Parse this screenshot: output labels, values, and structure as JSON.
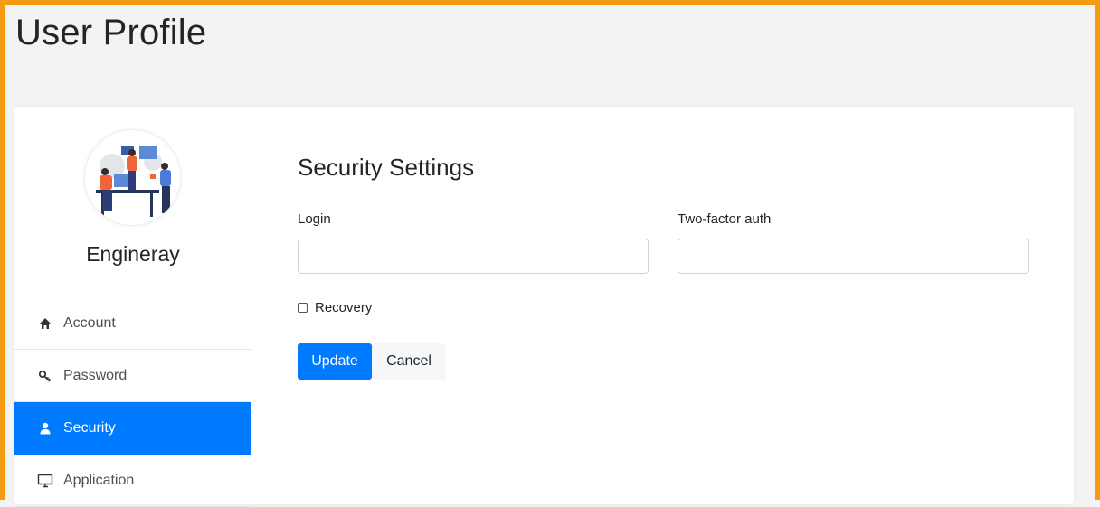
{
  "page": {
    "title": "User Profile"
  },
  "profile": {
    "name": "Engineray"
  },
  "sidebar": {
    "items": [
      {
        "label": "Account",
        "icon": "home-icon",
        "active": false
      },
      {
        "label": "Password",
        "icon": "key-icon",
        "active": false
      },
      {
        "label": "Security",
        "icon": "user-icon",
        "active": true
      },
      {
        "label": "Application",
        "icon": "monitor-icon",
        "active": false
      }
    ]
  },
  "security": {
    "title": "Security Settings",
    "login_label": "Login",
    "login_value": "",
    "twofactor_label": "Two-factor auth",
    "twofactor_value": "",
    "recovery_label": "Recovery",
    "recovery_checked": false,
    "update_label": "Update",
    "cancel_label": "Cancel"
  },
  "colors": {
    "accent": "#007bff",
    "frame": "#f39c12",
    "background": "#f3f3f3"
  }
}
